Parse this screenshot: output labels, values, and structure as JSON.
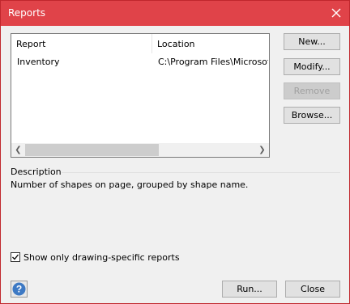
{
  "window": {
    "title": "Reports"
  },
  "list": {
    "columns": [
      "Report",
      "Location"
    ],
    "rows": [
      {
        "name": "Inventory",
        "location": "C:\\Program Files\\Microsoft"
      }
    ]
  },
  "side_buttons": {
    "new": "New...",
    "modify": "Modify...",
    "remove": "Remove",
    "browse": "Browse..."
  },
  "description": {
    "label": "Description",
    "text": "Number of shapes on page, grouped by shape name."
  },
  "filter_checkbox": {
    "label": "Show only drawing-specific reports",
    "checked": true
  },
  "bottom_buttons": {
    "run": "Run...",
    "close": "Close"
  },
  "colors": {
    "titlebar": "#e04349",
    "help_icon": "#3d79c4"
  }
}
